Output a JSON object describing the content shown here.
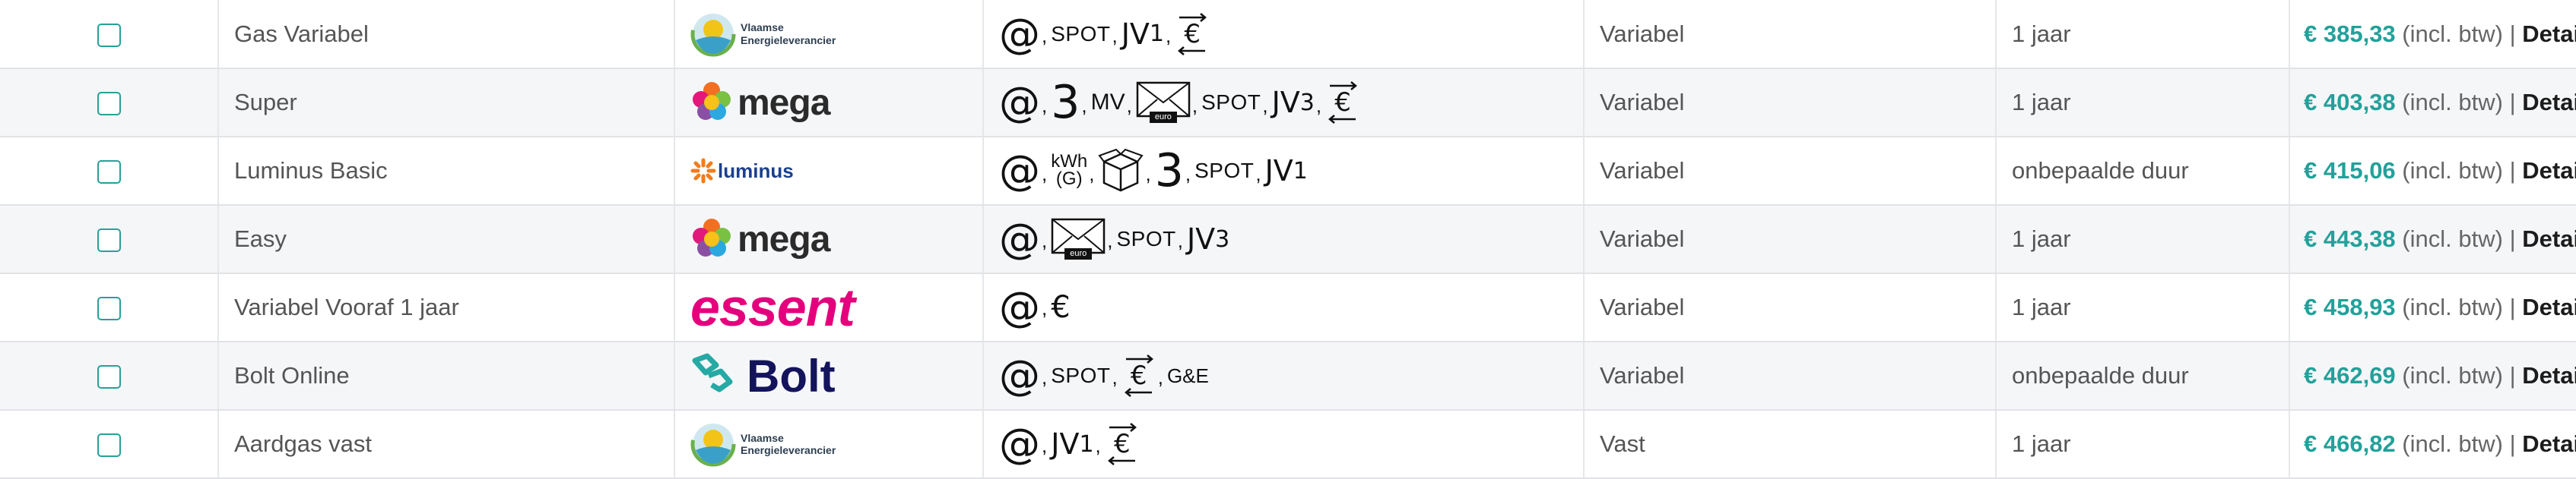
{
  "colors": {
    "accent": "#22a19a",
    "essent": "#e4007d",
    "bolt_navy": "#14145c",
    "bolt_teal": "#25a9a4",
    "luminus_orange": "#f07d1e",
    "luminus_blue": "#1a3f8f"
  },
  "labels": {
    "incl": "(incl. btw)",
    "separator": "|",
    "details": "Details",
    "arrows": ">>"
  },
  "glyphs": {
    "at": "@",
    "comma": ",",
    "spot": "SPOT",
    "three": "3",
    "mv": "MV",
    "euro": "€",
    "kwh": "kWh",
    "g": "(G)",
    "ge": "G&E",
    "jv": "JV",
    "jv1": "1",
    "jv3": "3",
    "envelope_caption": "euro"
  },
  "logos": {
    "vlaamse_line1": "Vlaamse",
    "vlaamse_line2": "Energieleverancier",
    "mega": "mega",
    "luminus": "luminus",
    "essent": "essent",
    "bolt": "Bolt"
  },
  "rows": [
    {
      "name": "Gas Variabel",
      "logo": "vlaamse",
      "icons": [
        "at",
        "spot",
        "jv1",
        "euro-arrows"
      ],
      "type": "Variabel",
      "duration": "1 jaar",
      "price": "€ 385,33"
    },
    {
      "name": "Super",
      "logo": "mega",
      "icons": [
        "at",
        "three",
        "mv",
        "envelope",
        "spot",
        "jv3",
        "euro-arrows"
      ],
      "type": "Variabel",
      "duration": "1 jaar",
      "price": "€ 403,38"
    },
    {
      "name": "Luminus Basic",
      "logo": "luminus",
      "icons": [
        "at",
        "kwh",
        "box",
        "three",
        "spot",
        "jv1"
      ],
      "type": "Variabel",
      "duration": "onbepaalde duur",
      "price": "€ 415,06"
    },
    {
      "name": "Easy",
      "logo": "mega",
      "icons": [
        "at",
        "envelope",
        "spot",
        "jv3"
      ],
      "type": "Variabel",
      "duration": "1 jaar",
      "price": "€ 443,38"
    },
    {
      "name": "Variabel Vooraf 1 jaar",
      "logo": "essent",
      "icons": [
        "at",
        "euro"
      ],
      "type": "Variabel",
      "duration": "1 jaar",
      "price": "€ 458,93"
    },
    {
      "name": "Bolt Online",
      "logo": "bolt",
      "icons": [
        "at",
        "spot",
        "euro-arrows",
        "ge"
      ],
      "type": "Variabel",
      "duration": "onbepaalde duur",
      "price": "€ 462,69"
    },
    {
      "name": "Aardgas vast",
      "logo": "vlaamse",
      "icons": [
        "at",
        "jv1",
        "euro-arrows"
      ],
      "type": "Vast",
      "duration": "1 jaar",
      "price": "€ 466,82"
    }
  ]
}
